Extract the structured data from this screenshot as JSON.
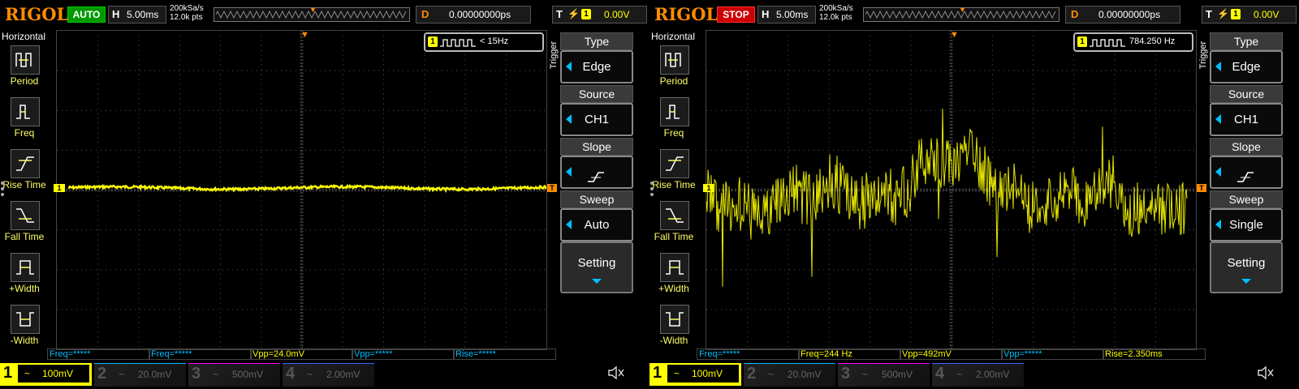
{
  "left": {
    "logo": "RIGOL",
    "run_state": "AUTO",
    "timebase": {
      "label": "H",
      "value": "5.00ms"
    },
    "sample_rate": "200kSa/s",
    "memory_depth": "12.0k pts",
    "delay": {
      "label": "D",
      "value": "0.00000000ps"
    },
    "trigger": {
      "label": "T",
      "channel": "1",
      "level": "0.00V"
    },
    "horizontal_title": "Horizontal",
    "measure_items": [
      "Period",
      "Freq",
      "Rise Time",
      "Fall Time",
      "+Width",
      "-Width"
    ],
    "freq_counter": {
      "channel": "1",
      "value": "< 15Hz"
    },
    "trigger_menu_title": "Trigger",
    "menu": [
      {
        "title": "Type",
        "value": "Edge"
      },
      {
        "title": "Source",
        "value": "CH1"
      },
      {
        "title": "Slope",
        "value": ""
      },
      {
        "title": "Sweep",
        "value": "Auto"
      }
    ],
    "setting_label": "Setting",
    "measurements": [
      "Freq=*****",
      "Freq=*****",
      "Vpp=24.0mV",
      "Vpp=*****",
      "Rise=*****"
    ],
    "channels": [
      {
        "num": "1",
        "coupling": "~",
        "scale": "100mV",
        "color": "#ffff00"
      },
      {
        "num": "2",
        "coupling": "~",
        "scale": "20.0mV",
        "color": "#00bfff"
      },
      {
        "num": "3",
        "coupling": "~",
        "scale": "500mV",
        "color": "#ff00ff"
      },
      {
        "num": "4",
        "coupling": "~",
        "scale": "2.00mV",
        "color": "#3366ff"
      }
    ]
  },
  "right": {
    "logo": "RIGOL",
    "run_state": "STOP",
    "timebase": {
      "label": "H",
      "value": "5.00ms"
    },
    "sample_rate": "200kSa/s",
    "memory_depth": "12.0k pts",
    "delay": {
      "label": "D",
      "value": "0.00000000ps"
    },
    "trigger": {
      "label": "T",
      "channel": "1",
      "level": "0.00V"
    },
    "horizontal_title": "Horizontal",
    "measure_items": [
      "Period",
      "Freq",
      "Rise Time",
      "Fall Time",
      "+Width",
      "-Width"
    ],
    "freq_counter": {
      "channel": "1",
      "value": "784.250 Hz"
    },
    "trigger_menu_title": "Trigger",
    "menu": [
      {
        "title": "Type",
        "value": "Edge"
      },
      {
        "title": "Source",
        "value": "CH1"
      },
      {
        "title": "Slope",
        "value": ""
      },
      {
        "title": "Sweep",
        "value": "Single"
      }
    ],
    "setting_label": "Setting",
    "measurements": [
      "Freq=*****",
      "Freq=244 Hz",
      "Vpp=492mV",
      "Vpp=*****",
      "Rise=2.350ms"
    ],
    "channels": [
      {
        "num": "1",
        "coupling": "~",
        "scale": "100mV",
        "color": "#ffff00"
      },
      {
        "num": "2",
        "coupling": "~",
        "scale": "20.0mV",
        "color": "#00bfff"
      },
      {
        "num": "3",
        "coupling": "~",
        "scale": "500mV",
        "color": "#ff00ff"
      },
      {
        "num": "4",
        "coupling": "~",
        "scale": "2.00mV",
        "color": "#3366ff"
      }
    ]
  },
  "colors": {
    "accent": "#ff8c00",
    "ch1": "#ffff00",
    "menu_arrow": "#00bfff",
    "meas_label": "#ffff66"
  },
  "icons": [
    "period-icon",
    "freq-icon",
    "rise-time-icon",
    "fall-time-icon",
    "pos-width-icon",
    "neg-width-icon",
    "speaker-mute-icon"
  ]
}
